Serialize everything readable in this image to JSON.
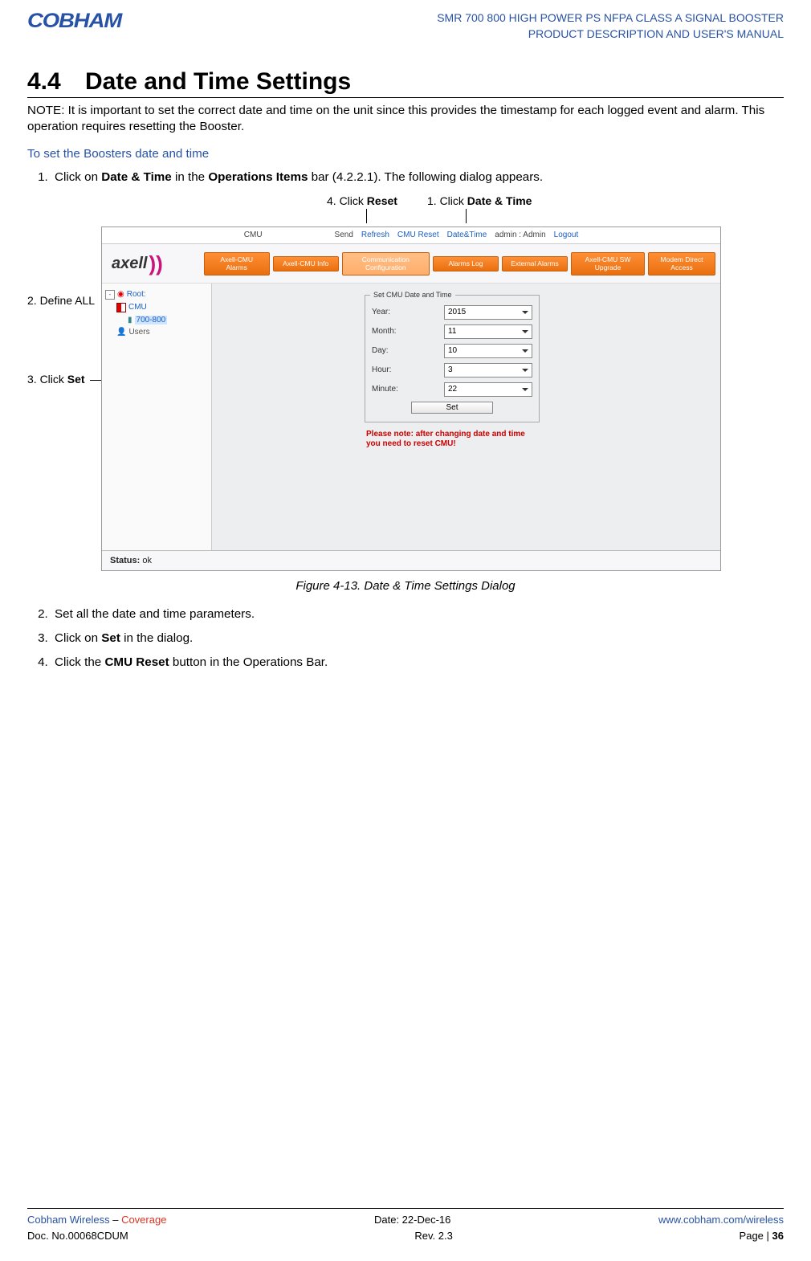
{
  "header": {
    "logo": "COBHAM",
    "line1": "SMR 700 800 HIGH POWER PS NFPA CLASS A SIGNAL BOOSTER",
    "line2": "PRODUCT DESCRIPTION AND USER'S MANUAL"
  },
  "section": {
    "number": "4.4",
    "title": "Date and Time Settings"
  },
  "note": "NOTE: It is important to set the correct date and time on the unit since this provides the timestamp for each logged event and alarm.  This operation requires resetting the Booster.",
  "sub_heading": "To set the Boosters date and time",
  "steps": {
    "s1_pre": "Click on ",
    "s1_b1": "Date & Time",
    "s1_mid": " in the ",
    "s1_b2": "Operations Items",
    "s1_post": " bar (4.2.2.1).  The following dialog appears.",
    "s2": "Set all the date and time parameters.",
    "s3_pre": "Click on ",
    "s3_b": "Set",
    "s3_post": " in the dialog.",
    "s4_pre": "Click the ",
    "s4_b": "CMU Reset",
    "s4_post": " button in the Operations Bar."
  },
  "annotations": {
    "top4_pre": "4. Click ",
    "top4_b": "Reset",
    "top1_pre": "1. Click ",
    "top1_b": "Date & Time",
    "left2": "2. Define ALL",
    "left3_pre": "3. Click ",
    "left3_b": "Set"
  },
  "screenshot": {
    "topbar": {
      "cmu": "CMU",
      "send": "Send",
      "refresh": "Refresh",
      "cmu_reset": "CMU Reset",
      "date_time": "Date&Time",
      "admin": "admin : Admin",
      "logout": "Logout"
    },
    "logo": {
      "text": "axell",
      "swoosh": "))"
    },
    "tabs": [
      "Axell-CMU Alarms",
      "Axell-CMU Info",
      "Communication Configuration",
      "Alarms Log",
      "External Alarms",
      "Axell-CMU SW Upgrade",
      "Modem Direct Access"
    ],
    "tree": {
      "root": "Root:",
      "cmu": "CMU",
      "band": "700-800",
      "users": "Users"
    },
    "fieldset": {
      "title": "Set CMU Date and Time",
      "rows": [
        {
          "label": "Year:",
          "value": "2015"
        },
        {
          "label": "Month:",
          "value": "11"
        },
        {
          "label": "Day:",
          "value": "10"
        },
        {
          "label": "Hour:",
          "value": "3"
        },
        {
          "label": "Minute:",
          "value": "22"
        }
      ],
      "button": "Set"
    },
    "warn": "Please note: after changing date and time you need to reset CMU!",
    "status_label": "Status:",
    "status_value": "ok"
  },
  "fig_caption": "Figure 4-13. Date & Time Settings Dialog",
  "footer": {
    "l1a": "Cobham Wireless",
    "l1b": " – ",
    "l1c": "Coverage",
    "l1_mid": "Date: 22-Dec-16",
    "l1_right": "www.cobham.com/wireless",
    "l2_left": "Doc. No.00068CDUM",
    "l2_mid": "Rev. 2.3",
    "l2_right_pre": "Page | ",
    "l2_right_b": "36"
  }
}
